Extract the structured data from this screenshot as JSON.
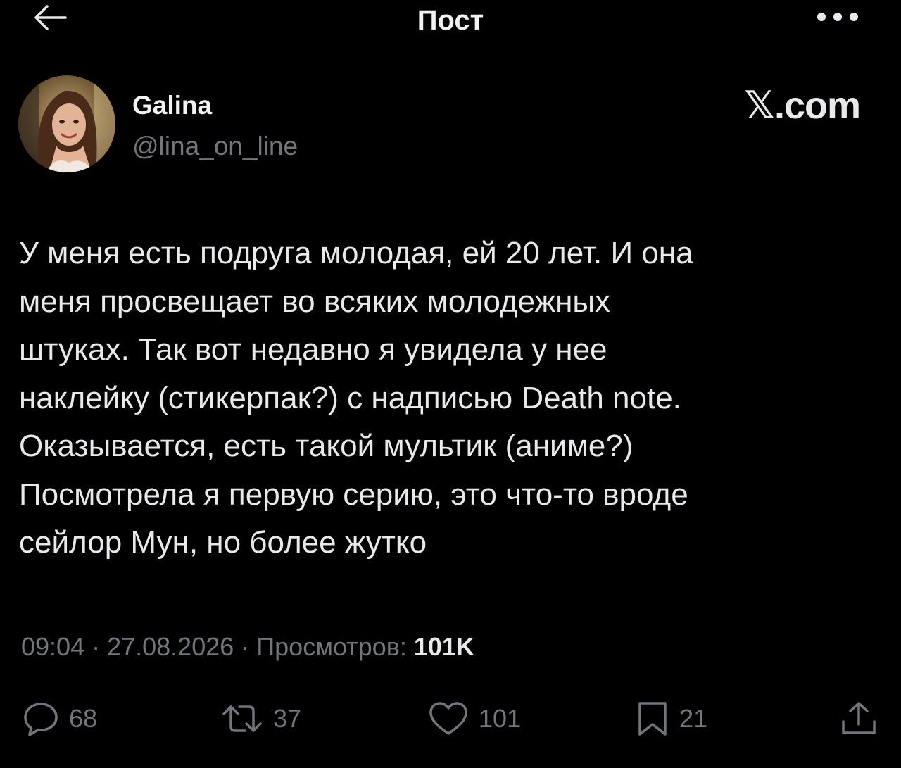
{
  "header": {
    "title": "Пост"
  },
  "author": {
    "display_name": "Galina",
    "handle": "@lina_on_line"
  },
  "brand": {
    "label": "𝕏.com"
  },
  "tweet": {
    "lines": [
      "У меня есть подруга молодая, ей 20 лет. И она",
      "меня просвещает во всяких молодежных",
      "штуках. Так вот недавно я увидела у нее",
      "наклейку (стикерпак?) с надписью Death note.",
      "Оказывается, есть такой мультик (аниме?)",
      "Посмотрела я первую серию, это что-то вроде",
      "сейлор Мун, но более жутко"
    ]
  },
  "meta": {
    "time": "09:04",
    "separator": " · ",
    "date": "27.08.2026",
    "views_label": "Просмотров: ",
    "views_count": "101K"
  },
  "actions": {
    "replies": "68",
    "reposts": "37",
    "likes": "101",
    "bookmarks": "21"
  },
  "colors": {
    "background": "#000000",
    "text_primary": "#e7e9ea",
    "text_secondary": "#71767b"
  },
  "icons": {
    "back": "arrow-left-icon",
    "more": "more-dots-icon",
    "reply": "reply-bubble-icon",
    "repost": "repost-arrows-icon",
    "like": "heart-icon",
    "bookmark": "bookmark-icon",
    "share": "share-upload-icon"
  }
}
